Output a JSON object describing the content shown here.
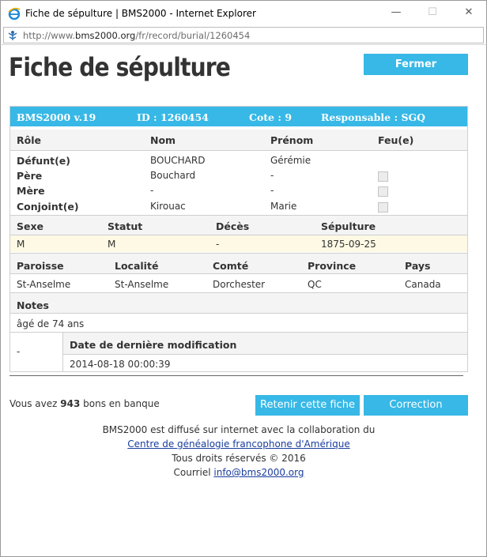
{
  "window": {
    "title": "Fiche de sépulture | BMS2000 - Internet Explorer",
    "url_prefix": "http://www.",
    "url_domain": "bms2000.org",
    "url_path": "/fr/record/burial/1260454",
    "min_symbol": "—",
    "max_symbol": "☐",
    "close_symbol": "✕"
  },
  "page": {
    "title": "Fiche de sépulture",
    "close_button": "Fermer"
  },
  "record": {
    "header": {
      "version": "BMS2000 v.19",
      "id": "ID : 1260454",
      "cote": "Cote : 9",
      "responsable": "Responsable : SGQ"
    },
    "persons_headers": [
      "Rôle",
      "Nom",
      "Prénom",
      "Feu(e)"
    ],
    "persons": [
      {
        "role": "Défunt(e)",
        "nom": "BOUCHARD",
        "prenom": "Gérémie",
        "checkbox": false
      },
      {
        "role": "Père",
        "nom": "Bouchard",
        "prenom": "-",
        "checkbox": true
      },
      {
        "role": "Mère",
        "nom": "-",
        "prenom": "-",
        "checkbox": true
      },
      {
        "role": "Conjoint(e)",
        "nom": "Kirouac",
        "prenom": "Marie",
        "checkbox": true
      }
    ],
    "status_headers": [
      "Sexe",
      "Statut",
      "Décès",
      "Sépulture"
    ],
    "status_values": [
      "M",
      "M",
      "-",
      "1875-09-25"
    ],
    "place_headers": [
      "Paroisse",
      "Localité",
      "Comté",
      "Province",
      "Pays"
    ],
    "place_values": [
      "St-Anselme",
      "St-Anselme",
      "Dorchester",
      "QC",
      "Canada"
    ],
    "notes_label": "Notes",
    "notes_value": "âgé de 74 ans",
    "mod_left": "-",
    "mod_label": "Date de dernière modification",
    "mod_value": "2014-08-18 00:00:39"
  },
  "bank": {
    "prefix": "Vous avez",
    "count": "943",
    "suffix": "bons en banque"
  },
  "actions": {
    "retain": "Retenir cette fiche",
    "correction": "Correction"
  },
  "footer": {
    "line1": "BMS2000 est diffusé sur internet avec la collaboration du",
    "link1": "Centre de généalogie francophone d'Amérique",
    "line3": "Tous droits réservés © 2016",
    "line4_prefix": "Courriel",
    "email": "info@bms2000.org"
  },
  "colors": {
    "accent": "#37b8e6",
    "link": "#1a3d9e",
    "highlight_row": "#fdf9e4"
  }
}
